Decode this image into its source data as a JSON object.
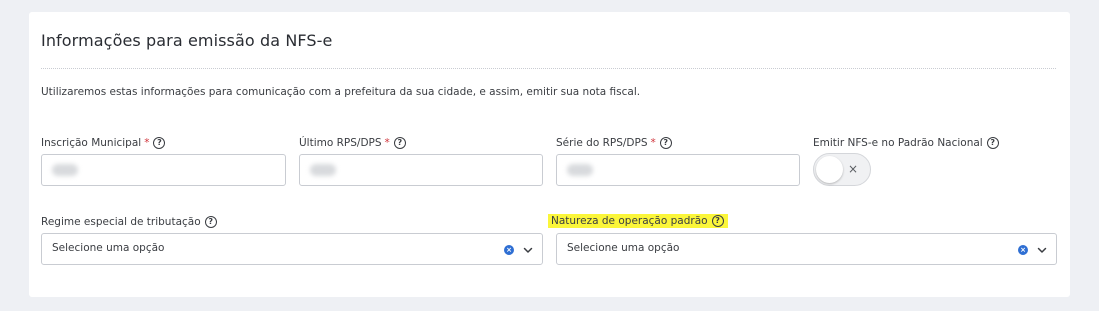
{
  "section": {
    "title": "Informações para emissão da NFS-e",
    "description": "Utilizaremos estas informações para comunicação com a prefeitura da sua cidade, e assim, emitir sua nota fiscal."
  },
  "fields": {
    "inscricao_municipal": {
      "label": "Inscrição Municipal",
      "required_mark": "*",
      "help": "?"
    },
    "ultimo_rps": {
      "label": "Último RPS/DPS",
      "required_mark": "*",
      "help": "?"
    },
    "serie_rps": {
      "label": "Série do RPS/DPS",
      "required_mark": "*",
      "help": "?"
    },
    "emitir_padrao_nacional": {
      "label": "Emitir NFS-e no Padrão Nacional",
      "help": "?",
      "toggle_state": "off",
      "toggle_icon": "×"
    },
    "regime_especial": {
      "label": "Regime especial de tributação",
      "help": "?",
      "value": "Selecione uma opção",
      "clear_icon": "×"
    },
    "natureza_operacao": {
      "label": "Natureza de operação padrão",
      "help": "?",
      "value": "Selecione uma opção",
      "clear_icon": "×",
      "highlight_color": "#fbf63a"
    }
  },
  "colors": {
    "required": "#d0343b",
    "clear_icon": "#2f6fd3",
    "background": "#eef0f4"
  }
}
